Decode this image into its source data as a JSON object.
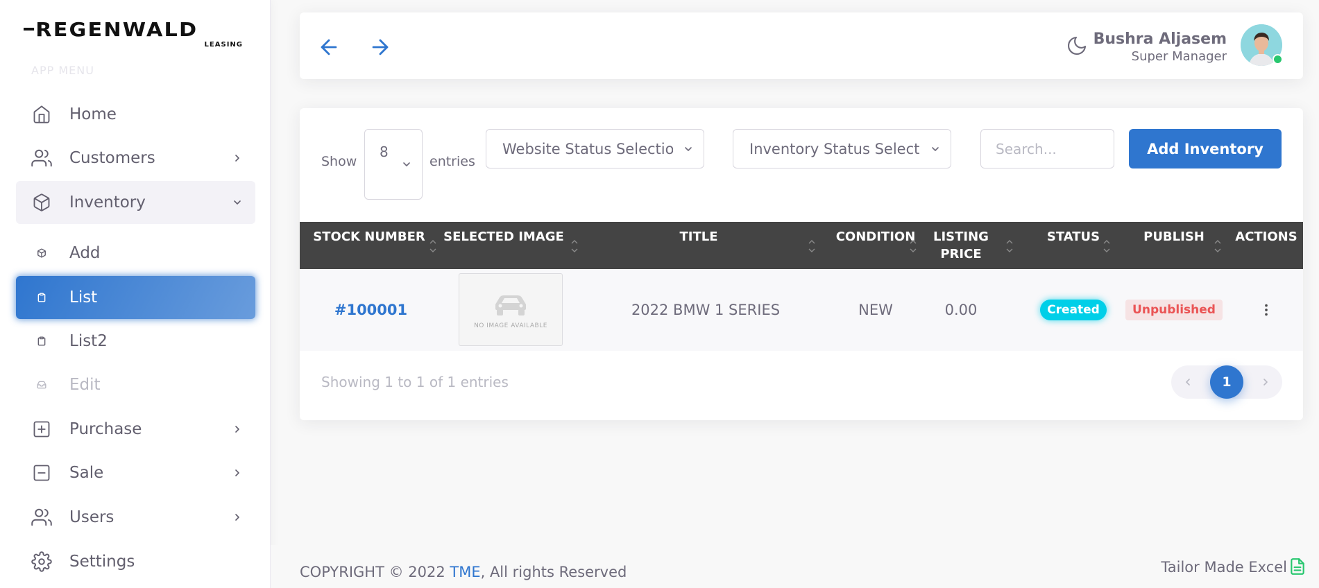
{
  "brand": {
    "name": "REGENWALD",
    "sub": "LEASING"
  },
  "sidebar": {
    "menu_header": "APP MENU",
    "items": [
      {
        "label": "Home"
      },
      {
        "label": "Customers"
      },
      {
        "label": "Inventory"
      },
      {
        "label": "Add"
      },
      {
        "label": "List"
      },
      {
        "label": "List2"
      },
      {
        "label": "Edit"
      },
      {
        "label": "Purchase"
      },
      {
        "label": "Sale"
      },
      {
        "label": "Users"
      },
      {
        "label": "Settings"
      }
    ]
  },
  "user": {
    "name": "Bushra Aljasem",
    "role": "Super Manager",
    "online": true
  },
  "toolbar": {
    "show_label": "Show",
    "entries_value": "8",
    "entries_label": "entries",
    "website_status_placeholder": "Website Status Selection",
    "inventory_status_placeholder": "Inventory Status Selection",
    "search_placeholder": "Search...",
    "add_button": "Add Inventory"
  },
  "table": {
    "columns": [
      "STOCK NUMBER",
      "SELECTED IMAGE",
      "TITLE",
      "CONDITION",
      "LISTING PRICE",
      "STATUS",
      "PUBLISH",
      "ACTIONS"
    ],
    "rows": [
      {
        "stock_number": "#100001",
        "image_text": "NO IMAGE AVAILABLE",
        "title": "2022 BMW 1 SERIES",
        "condition": "NEW",
        "listing_price": "0.00",
        "status": "Created",
        "publish": "Unpublished"
      }
    ]
  },
  "pagination": {
    "info": "Showing 1 to 1 of 1 entries",
    "current_page": "1"
  },
  "footer": {
    "copyright_prefix": "COPYRIGHT © 2022 ",
    "company": "TME",
    "copyright_suffix": ", All rights Reserved",
    "right_text": "Tailor Made Excel"
  },
  "colors": {
    "primary": "#2f76cf",
    "created_badge": "#00cfe8",
    "unpublished_badge": "#ea5455",
    "table_header": "#444444",
    "online": "#28c76f"
  }
}
